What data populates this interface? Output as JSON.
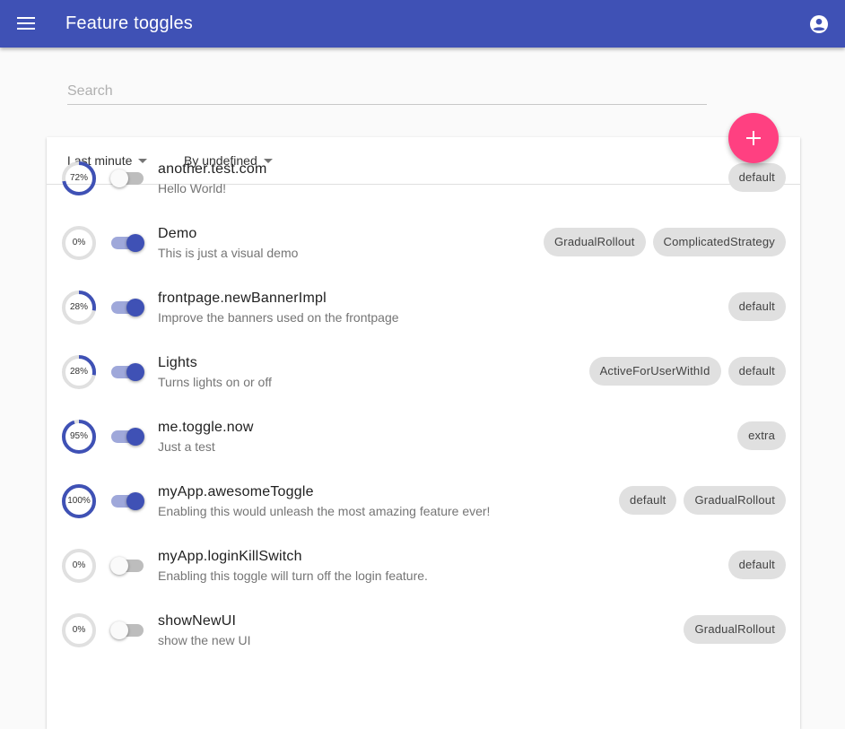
{
  "app": {
    "title": "Feature toggles",
    "menu_icon": "menu-icon",
    "account_icon": "account-circle-icon"
  },
  "search": {
    "placeholder": "Search",
    "value": ""
  },
  "filters": {
    "time": "Last minute",
    "metric": "By undefined"
  },
  "add_button": {
    "icon": "plus-icon"
  },
  "colors": {
    "primary": "#3f51b5",
    "accent": "#ff4081",
    "chip_bg": "#e0e0e0",
    "switch_on_track": "#9fa8da"
  },
  "features": [
    {
      "name": "another.test.com",
      "description": "Hello World!",
      "percent": 72,
      "percent_label": "72%",
      "enabled": false,
      "strategies": [
        "default"
      ]
    },
    {
      "name": "Demo",
      "description": "This is just a visual demo",
      "percent": 0,
      "percent_label": "0%",
      "enabled": true,
      "strategies": [
        "GradualRollout",
        "ComplicatedStrategy"
      ]
    },
    {
      "name": "frontpage.newBannerImpl",
      "description": "Improve the banners used on the frontpage",
      "percent": 28,
      "percent_label": "28%",
      "enabled": true,
      "strategies": [
        "default"
      ]
    },
    {
      "name": "Lights",
      "description": "Turns lights on or off",
      "percent": 28,
      "percent_label": "28%",
      "enabled": true,
      "strategies": [
        "ActiveForUserWithId",
        "default"
      ]
    },
    {
      "name": "me.toggle.now",
      "description": "Just a test",
      "percent": 95,
      "percent_label": "95%",
      "enabled": true,
      "strategies": [
        "extra"
      ]
    },
    {
      "name": "myApp.awesomeToggle",
      "description": "Enabling this would unleash the most amazing feature ever!",
      "percent": 100,
      "percent_label": "100%",
      "enabled": true,
      "strategies": [
        "default",
        "GradualRollout"
      ]
    },
    {
      "name": "myApp.loginKillSwitch",
      "description": "Enabling this toggle will turn off the login feature.",
      "percent": 0,
      "percent_label": "0%",
      "enabled": false,
      "strategies": [
        "default"
      ]
    },
    {
      "name": "showNewUI",
      "description": "show the new UI",
      "percent": 0,
      "percent_label": "0%",
      "enabled": false,
      "strategies": [
        "GradualRollout"
      ]
    }
  ]
}
